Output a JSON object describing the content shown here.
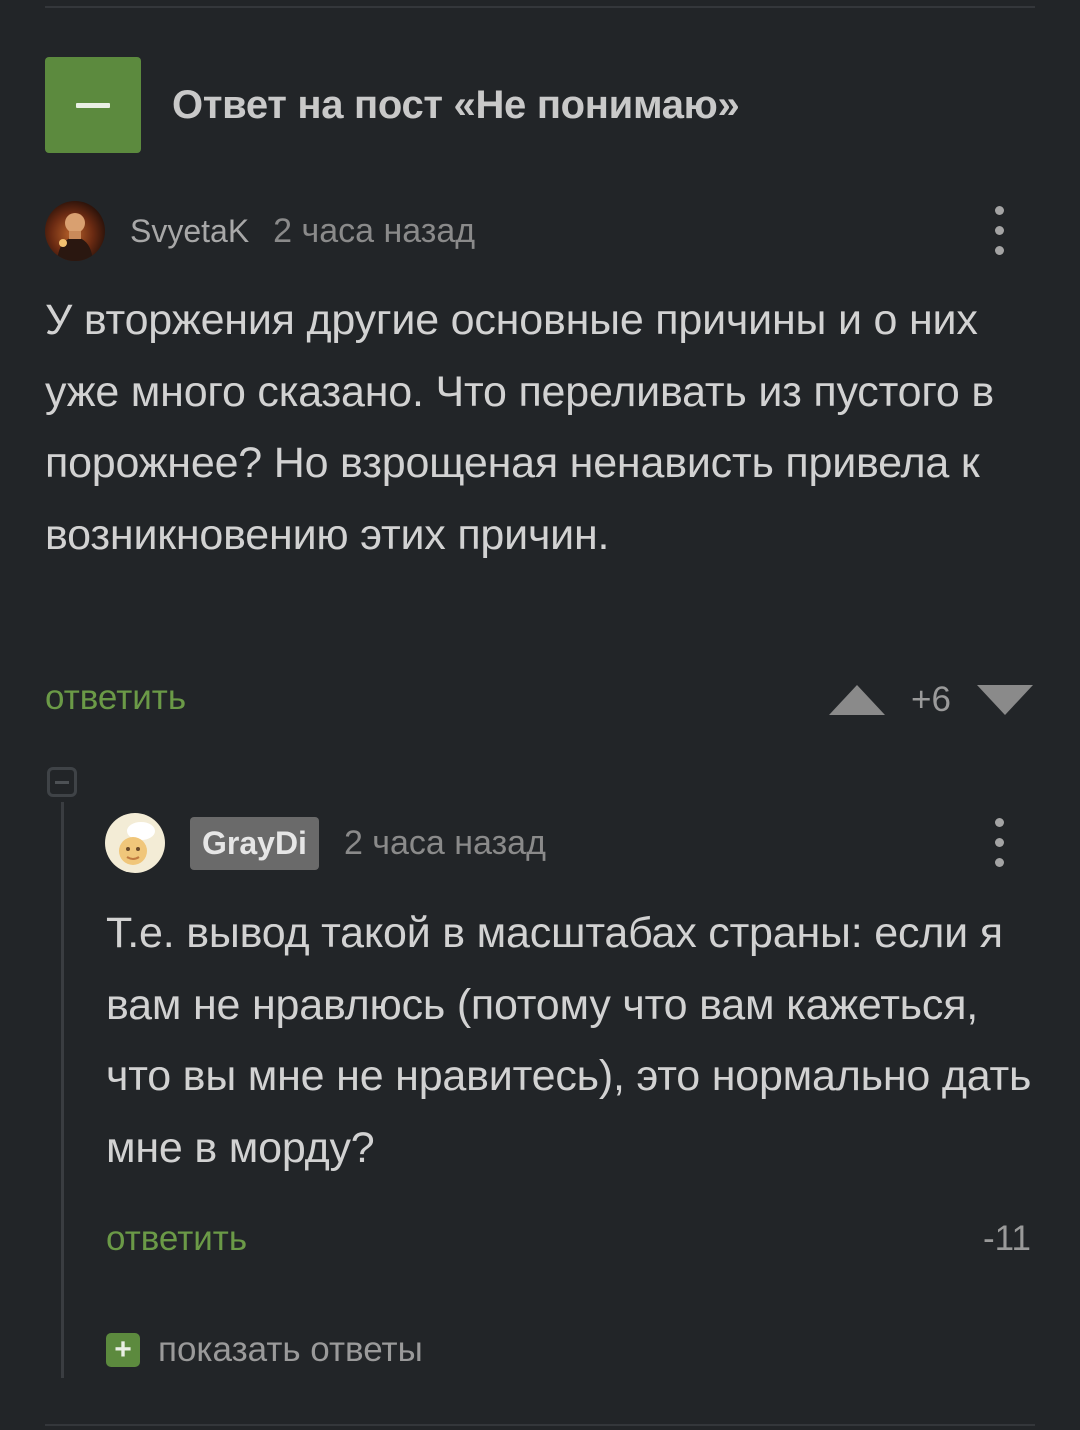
{
  "post": {
    "title": "Ответ на пост «Не понимаю»"
  },
  "comments": [
    {
      "username": "SvyetaK",
      "time": "2 часа назад",
      "text": "У вторжения другие основные причины и о них уже много сказано. Что переливать из пустого в порожнее? Но взрощеная ненависть привела к возникновению этих причин.",
      "reply_label": "ответить",
      "rating": "+6"
    },
    {
      "username": "GrayDi",
      "time": "2 часа назад",
      "text": "Т.е. вывод такой в масштабах страны: если я вам не нравлюсь (потому что вам кажеться, что вы мне не нравитесь), это нормально дать мне в морду?",
      "reply_label": "ответить",
      "rating": "-11",
      "show_replies_label": "показать ответы"
    }
  ],
  "colors": {
    "background": "#222528",
    "accent_green": "#5c8a3e",
    "link_green": "#6b9a47"
  },
  "icons": [
    "collapse-minus-icon",
    "more-vertical-icon",
    "upvote-arrow-icon",
    "downvote-arrow-icon",
    "plus-icon"
  ]
}
